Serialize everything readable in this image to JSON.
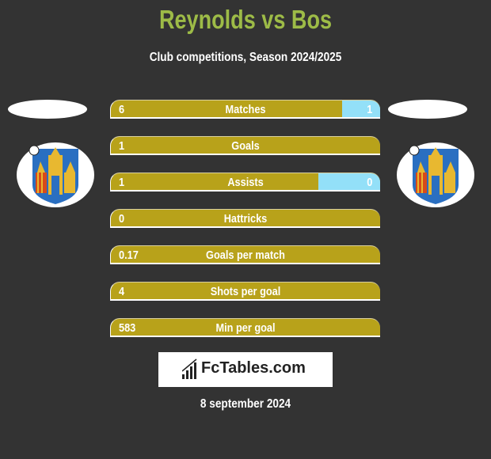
{
  "header": {
    "title": "Reynolds vs Bos",
    "subtitle": "Club competitions, Season 2024/2025"
  },
  "colors": {
    "title": "#9dbb47",
    "left_bar": "#b8a21a",
    "right_bar": "#93e0f8",
    "background": "#333333"
  },
  "players": {
    "left": {
      "name": "Reynolds",
      "club_crest_icon": "club-crest-icon"
    },
    "right": {
      "name": "Bos",
      "club_crest_icon": "club-crest-icon"
    }
  },
  "stats": [
    {
      "label": "Matches",
      "left": "6",
      "right": "1",
      "right_share": 0.14
    },
    {
      "label": "Goals",
      "left": "1",
      "right": "",
      "right_share": 0
    },
    {
      "label": "Assists",
      "left": "1",
      "right": "0",
      "right_share": 0.23
    },
    {
      "label": "Hattricks",
      "left": "0",
      "right": "",
      "right_share": 0
    },
    {
      "label": "Goals per match",
      "left": "0.17",
      "right": "",
      "right_share": 0
    },
    {
      "label": "Shots per goal",
      "left": "4",
      "right": "",
      "right_share": 0
    },
    {
      "label": "Min per goal",
      "left": "583",
      "right": "",
      "right_share": 0
    }
  ],
  "footer": {
    "logo_text": "FcTables.com",
    "date": "8 september 2024"
  }
}
